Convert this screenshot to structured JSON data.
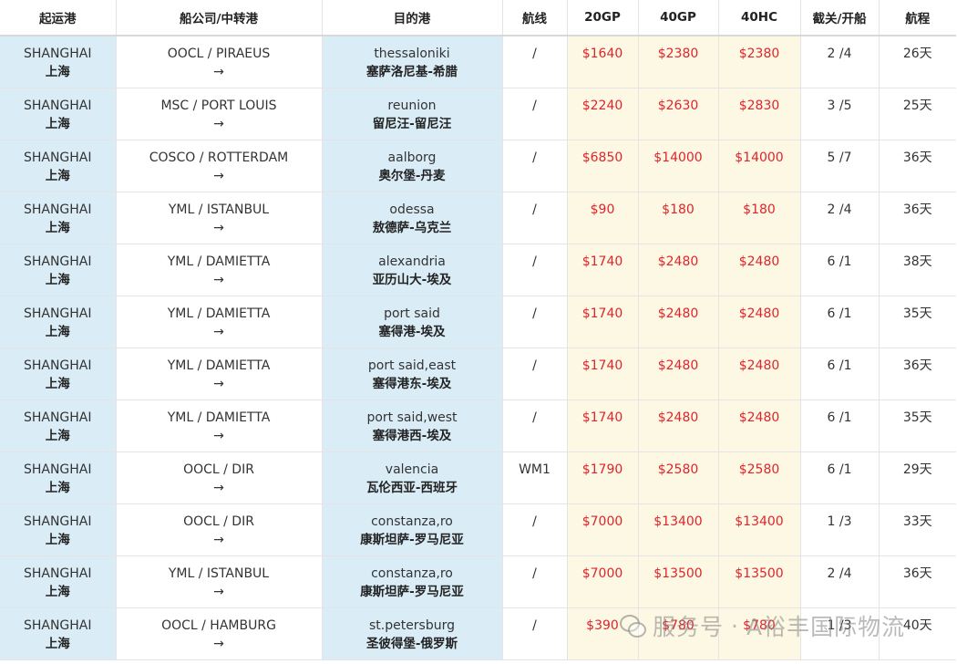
{
  "columns": [
    "起运港",
    "船公司/中转港",
    "目的港",
    "航线",
    "20GP",
    "40GP",
    "40HC",
    "截关/开船",
    "航程"
  ],
  "transit_arrow": "→",
  "rows": [
    {
      "origin_en": "SHANGHAI",
      "origin_cn": "上海",
      "carrier": "OOCL / PIRAEUS",
      "dest_en": "thessaloniki",
      "dest_cn": "塞萨洛尼基-希腊",
      "route": "/",
      "p20gp": "$1640",
      "p40gp": "$2380",
      "p40hc": "$2380",
      "schedule": "2 /4",
      "transit": "26天"
    },
    {
      "origin_en": "SHANGHAI",
      "origin_cn": "上海",
      "carrier": "MSC / PORT LOUIS",
      "dest_en": "reunion",
      "dest_cn": "留尼汪-留尼汪",
      "route": "/",
      "p20gp": "$2240",
      "p40gp": "$2630",
      "p40hc": "$2830",
      "schedule": "3 /5",
      "transit": "25天"
    },
    {
      "origin_en": "SHANGHAI",
      "origin_cn": "上海",
      "carrier": "COSCO / ROTTERDAM",
      "dest_en": "aalborg",
      "dest_cn": "奥尔堡-丹麦",
      "route": "/",
      "p20gp": "$6850",
      "p40gp": "$14000",
      "p40hc": "$14000",
      "schedule": "5 /7",
      "transit": "36天"
    },
    {
      "origin_en": "SHANGHAI",
      "origin_cn": "上海",
      "carrier": "YML / ISTANBUL",
      "dest_en": "odessa",
      "dest_cn": "敖德萨-乌克兰",
      "route": "/",
      "p20gp": "$90",
      "p40gp": "$180",
      "p40hc": "$180",
      "schedule": "2 /4",
      "transit": "36天"
    },
    {
      "origin_en": "SHANGHAI",
      "origin_cn": "上海",
      "carrier": "YML / DAMIETTA",
      "dest_en": "alexandria",
      "dest_cn": "亚历山大-埃及",
      "route": "/",
      "p20gp": "$1740",
      "p40gp": "$2480",
      "p40hc": "$2480",
      "schedule": "6 /1",
      "transit": "38天"
    },
    {
      "origin_en": "SHANGHAI",
      "origin_cn": "上海",
      "carrier": "YML / DAMIETTA",
      "dest_en": "port said",
      "dest_cn": "塞得港-埃及",
      "route": "/",
      "p20gp": "$1740",
      "p40gp": "$2480",
      "p40hc": "$2480",
      "schedule": "6 /1",
      "transit": "35天"
    },
    {
      "origin_en": "SHANGHAI",
      "origin_cn": "上海",
      "carrier": "YML / DAMIETTA",
      "dest_en": "port said,east",
      "dest_cn": "塞得港东-埃及",
      "route": "/",
      "p20gp": "$1740",
      "p40gp": "$2480",
      "p40hc": "$2480",
      "schedule": "6 /1",
      "transit": "36天"
    },
    {
      "origin_en": "SHANGHAI",
      "origin_cn": "上海",
      "carrier": "YML / DAMIETTA",
      "dest_en": "port said,west",
      "dest_cn": "塞得港西-埃及",
      "route": "/",
      "p20gp": "$1740",
      "p40gp": "$2480",
      "p40hc": "$2480",
      "schedule": "6 /1",
      "transit": "35天"
    },
    {
      "origin_en": "SHANGHAI",
      "origin_cn": "上海",
      "carrier": "OOCL / DIR",
      "dest_en": "valencia",
      "dest_cn": "瓦伦西亚-西班牙",
      "route": "WM1",
      "p20gp": "$1790",
      "p40gp": "$2580",
      "p40hc": "$2580",
      "schedule": "6 /1",
      "transit": "29天"
    },
    {
      "origin_en": "SHANGHAI",
      "origin_cn": "上海",
      "carrier": "OOCL / DIR",
      "dest_en": "constanza,ro",
      "dest_cn": "康斯坦萨-罗马尼亚",
      "route": "/",
      "p20gp": "$7000",
      "p40gp": "$13400",
      "p40hc": "$13400",
      "schedule": "1 /3",
      "transit": "33天"
    },
    {
      "origin_en": "SHANGHAI",
      "origin_cn": "上海",
      "carrier": "YML / ISTANBUL",
      "dest_en": "constanza,ro",
      "dest_cn": "康斯坦萨-罗马尼亚",
      "route": "/",
      "p20gp": "$7000",
      "p40gp": "$13500",
      "p40hc": "$13500",
      "schedule": "2 /4",
      "transit": "36天"
    },
    {
      "origin_en": "SHANGHAI",
      "origin_cn": "上海",
      "carrier": "OOCL / HAMBURG",
      "dest_en": "st.petersburg",
      "dest_cn": "圣彼得堡-俄罗斯",
      "route": "/",
      "p20gp": "$390",
      "p40gp": "$780",
      "p40hc": "$780",
      "schedule": "1 /3",
      "transit": "40天"
    }
  ],
  "watermark": {
    "icon": "wechat-icon",
    "account_label": "服务号",
    "separator": "·",
    "name": "A裕丰国际物流"
  },
  "colors": {
    "origin_bg": "#daedf7",
    "dest_bg": "#daedf7",
    "price_bg": "#fdf8e4",
    "price_text": "#e0242c"
  }
}
